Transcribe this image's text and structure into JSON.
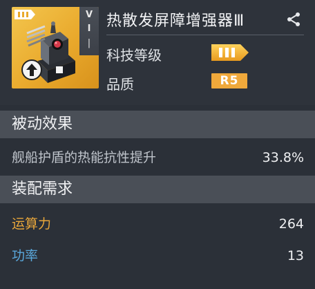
{
  "item": {
    "name": "热散发屏障增强器Ⅲ",
    "card_side_top": "V",
    "card_side_mid": "I",
    "card_side_bottom": "|"
  },
  "attributes": {
    "tech_level_label": "科技等级",
    "quality_label": "品质",
    "quality_value": "R5"
  },
  "sections": {
    "passive_title": "被动效果",
    "requirements_title": "装配需求"
  },
  "passive": {
    "label": "舰船护盾的热能抗性提升",
    "value": "33.8%"
  },
  "requirements": [
    {
      "label": "运算力",
      "value": "264",
      "color": "#e8a63a"
    },
    {
      "label": "功率",
      "value": "13",
      "color": "#5aa8dc"
    }
  ],
  "icons": [
    "share-icon",
    "tier-badge-icon",
    "upgrade-arrow-icon",
    "module-art"
  ],
  "colors": {
    "card_gold": "#e9a92c",
    "rarity_orange": "#f0a93b",
    "section_bg": "#4a4f57",
    "panel_bg": "#2b3038"
  }
}
